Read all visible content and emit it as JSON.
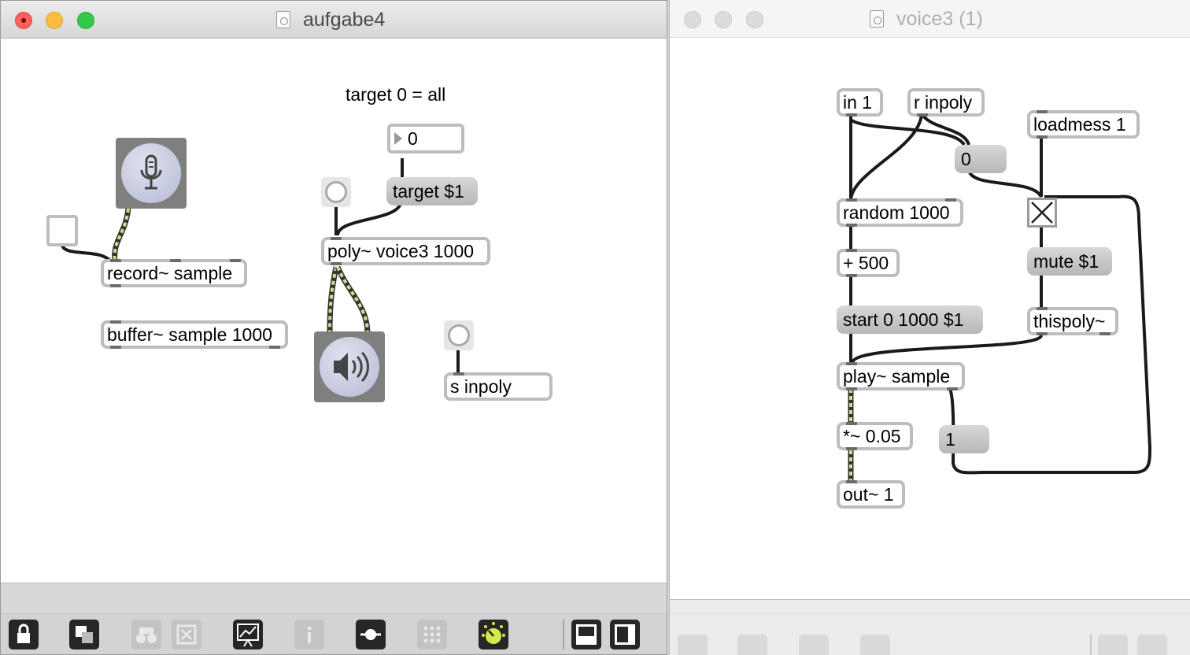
{
  "left_window": {
    "title": "aufgabe4",
    "comment": "target 0 = all",
    "number_box_value": "0",
    "target_message": "target $1",
    "poly_object": "poly~ voice3 1000",
    "record_object": "record~ sample",
    "buffer_object": "buffer~ sample 1000",
    "send_object": "s inpoly",
    "toolbar_icons": [
      "lock-icon",
      "presentation-mode-icon",
      "binoculars-icon",
      "close-box-icon",
      "patch-cord-icon",
      "info-icon",
      "slider-object-icon",
      "grid-icon",
      "dial-icon",
      "split-horizontal-icon",
      "sidebar-icon"
    ]
  },
  "right_window": {
    "title": "voice3 (1)",
    "in_object": "in 1",
    "receive_object": "r inpoly",
    "loadmess_object": "loadmess 1",
    "zero_message": "0",
    "random_object": "random 1000",
    "plus_object": "+ 500",
    "mute_message": "mute $1",
    "start_message": "start 0 1000 $1",
    "thispoly_object": "thispoly~",
    "play_object": "play~ sample",
    "multiply_object": "*~ 0.05",
    "one_message": "1",
    "out_object": "out~ 1"
  },
  "colors": {
    "signal_wire": "#c8e08a",
    "control_wire": "#1a1a1a",
    "object_border": "#bdbdbd",
    "message_fill": "#c8c8c8",
    "close_light": "#fc605b",
    "minimize_light": "#fdbc40",
    "zoom_light": "#34c84a"
  }
}
